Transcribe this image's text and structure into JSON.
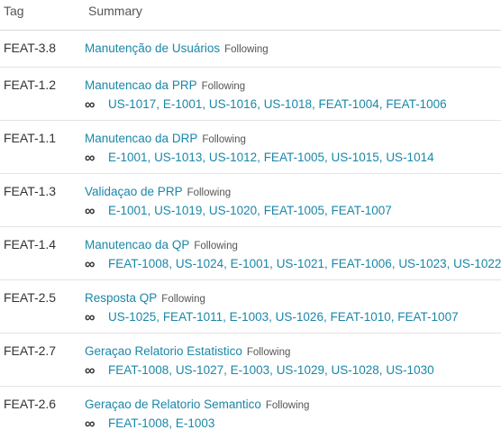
{
  "columns": {
    "tag": "Tag",
    "summary": "Summary"
  },
  "icon": "link-chain-icon",
  "accent": "#1a87a8",
  "rows": [
    {
      "tag": "FEAT-3.8",
      "title": "Manutenção de Usuários",
      "status": "Following",
      "links": []
    },
    {
      "tag": "FEAT-1.2",
      "title": "Manutencao da PRP",
      "status": "Following",
      "links": [
        "US-1017",
        "E-1001",
        "US-1016",
        "US-1018",
        "FEAT-1004",
        "FEAT-1006"
      ]
    },
    {
      "tag": "FEAT-1.1",
      "title": "Manutencao da DRP",
      "status": "Following",
      "links": [
        "E-1001",
        "US-1013",
        "US-1012",
        "FEAT-1005",
        "US-1015",
        "US-1014"
      ]
    },
    {
      "tag": "FEAT-1.3",
      "title": "Validaçao de PRP",
      "status": "Following",
      "links": [
        "E-1001",
        "US-1019",
        "US-1020",
        "FEAT-1005",
        "FEAT-1007"
      ]
    },
    {
      "tag": "FEAT-1.4",
      "title": "Manutencao da QP",
      "status": "Following",
      "links": [
        "FEAT-1008",
        "US-1024",
        "E-1001",
        "US-1021",
        "FEAT-1006",
        "US-1023",
        "US-1022"
      ]
    },
    {
      "tag": "FEAT-2.5",
      "title": "Resposta QP",
      "status": "Following",
      "links": [
        "US-1025",
        "FEAT-1011",
        "E-1003",
        "US-1026",
        "FEAT-1010",
        "FEAT-1007"
      ]
    },
    {
      "tag": "FEAT-2.7",
      "title": "Geraçao Relatorio Estatistico",
      "status": "Following",
      "links": [
        "FEAT-1008",
        "US-1027",
        "E-1003",
        "US-1029",
        "US-1028",
        "US-1030"
      ]
    },
    {
      "tag": "FEAT-2.6",
      "title": "Geraçao de Relatorio Semantico",
      "status": "Following",
      "links": [
        "FEAT-1008",
        "E-1003"
      ]
    }
  ]
}
